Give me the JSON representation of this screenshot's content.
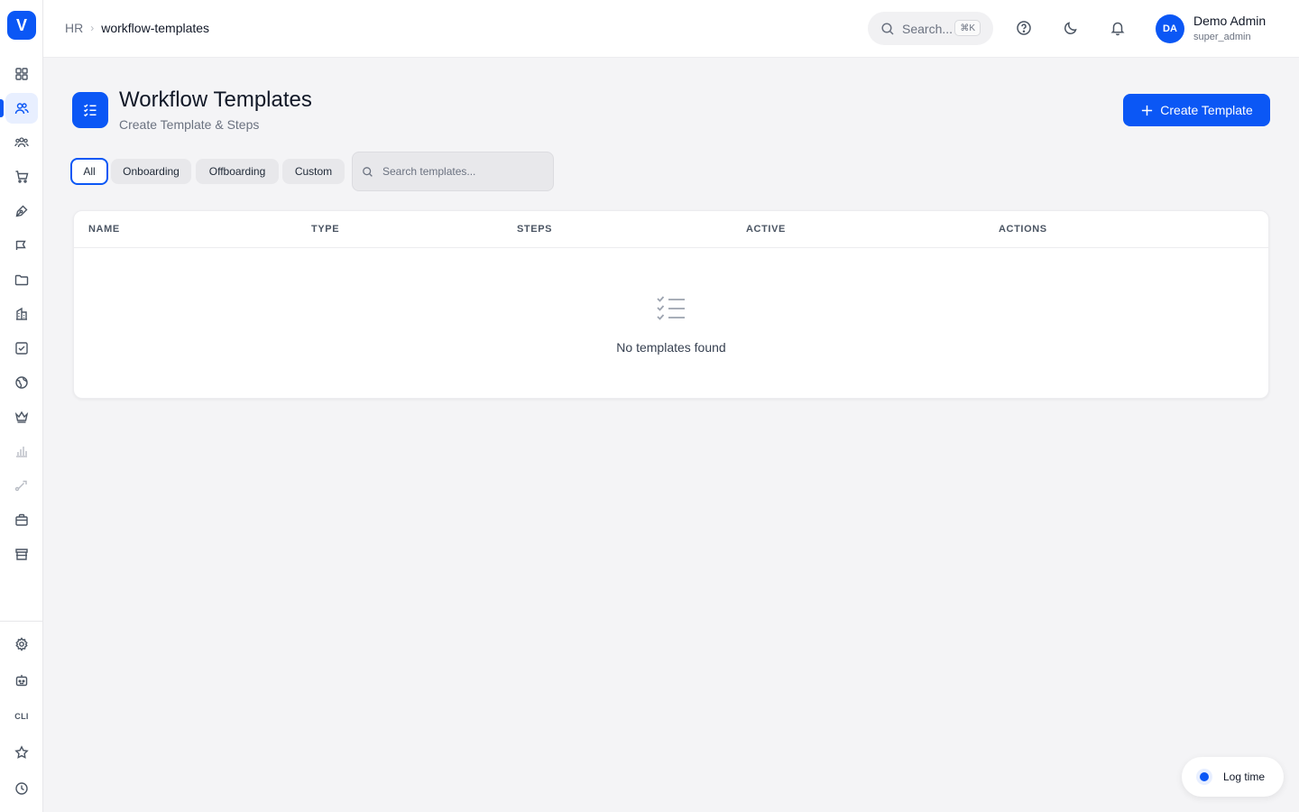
{
  "app": {
    "logo_letter": "V"
  },
  "breadcrumb": {
    "root": "HR",
    "separator": "›",
    "current": "workflow-templates"
  },
  "header": {
    "search_placeholder": "Search...",
    "search_shortcut": "⌘K",
    "user": {
      "initials": "DA",
      "name": "Demo Admin",
      "role": "super_admin"
    }
  },
  "sidebar": {
    "items": [
      {
        "icon": "dashboard-grid-icon"
      },
      {
        "icon": "users-icon",
        "active": true
      },
      {
        "icon": "team-icon"
      },
      {
        "icon": "cart-icon"
      },
      {
        "icon": "pen-tool-icon"
      },
      {
        "icon": "megaphone-icon"
      },
      {
        "icon": "folder-icon"
      },
      {
        "icon": "building-icon"
      },
      {
        "icon": "checkbox-icon"
      },
      {
        "icon": "globe-icon"
      },
      {
        "icon": "crown-icon"
      },
      {
        "icon": "bar-chart-icon"
      },
      {
        "icon": "route-icon"
      },
      {
        "icon": "briefcase-icon"
      },
      {
        "icon": "store-icon"
      }
    ],
    "bottom_items": [
      {
        "icon": "settings-gear-icon"
      },
      {
        "icon": "bot-icon"
      },
      {
        "icon": "cli-icon",
        "label": "CLI"
      },
      {
        "icon": "star-icon"
      },
      {
        "icon": "clock-icon"
      }
    ]
  },
  "page": {
    "title": "Workflow Templates",
    "subtitle": "Create Template & Steps",
    "create_button": "Create Template"
  },
  "filters": {
    "tabs": [
      "All",
      "Onboarding",
      "Offboarding",
      "Custom"
    ],
    "active": "All",
    "search_placeholder": "Search templates..."
  },
  "table": {
    "columns": [
      "NAME",
      "TYPE",
      "STEPS",
      "ACTIVE",
      "ACTIONS"
    ],
    "rows": [],
    "empty_message": "No templates found"
  },
  "floating": {
    "log_time_label": "Log time"
  },
  "colors": {
    "accent": "#0b57f5",
    "background": "#f4f4f6",
    "surface": "#ffffff"
  }
}
